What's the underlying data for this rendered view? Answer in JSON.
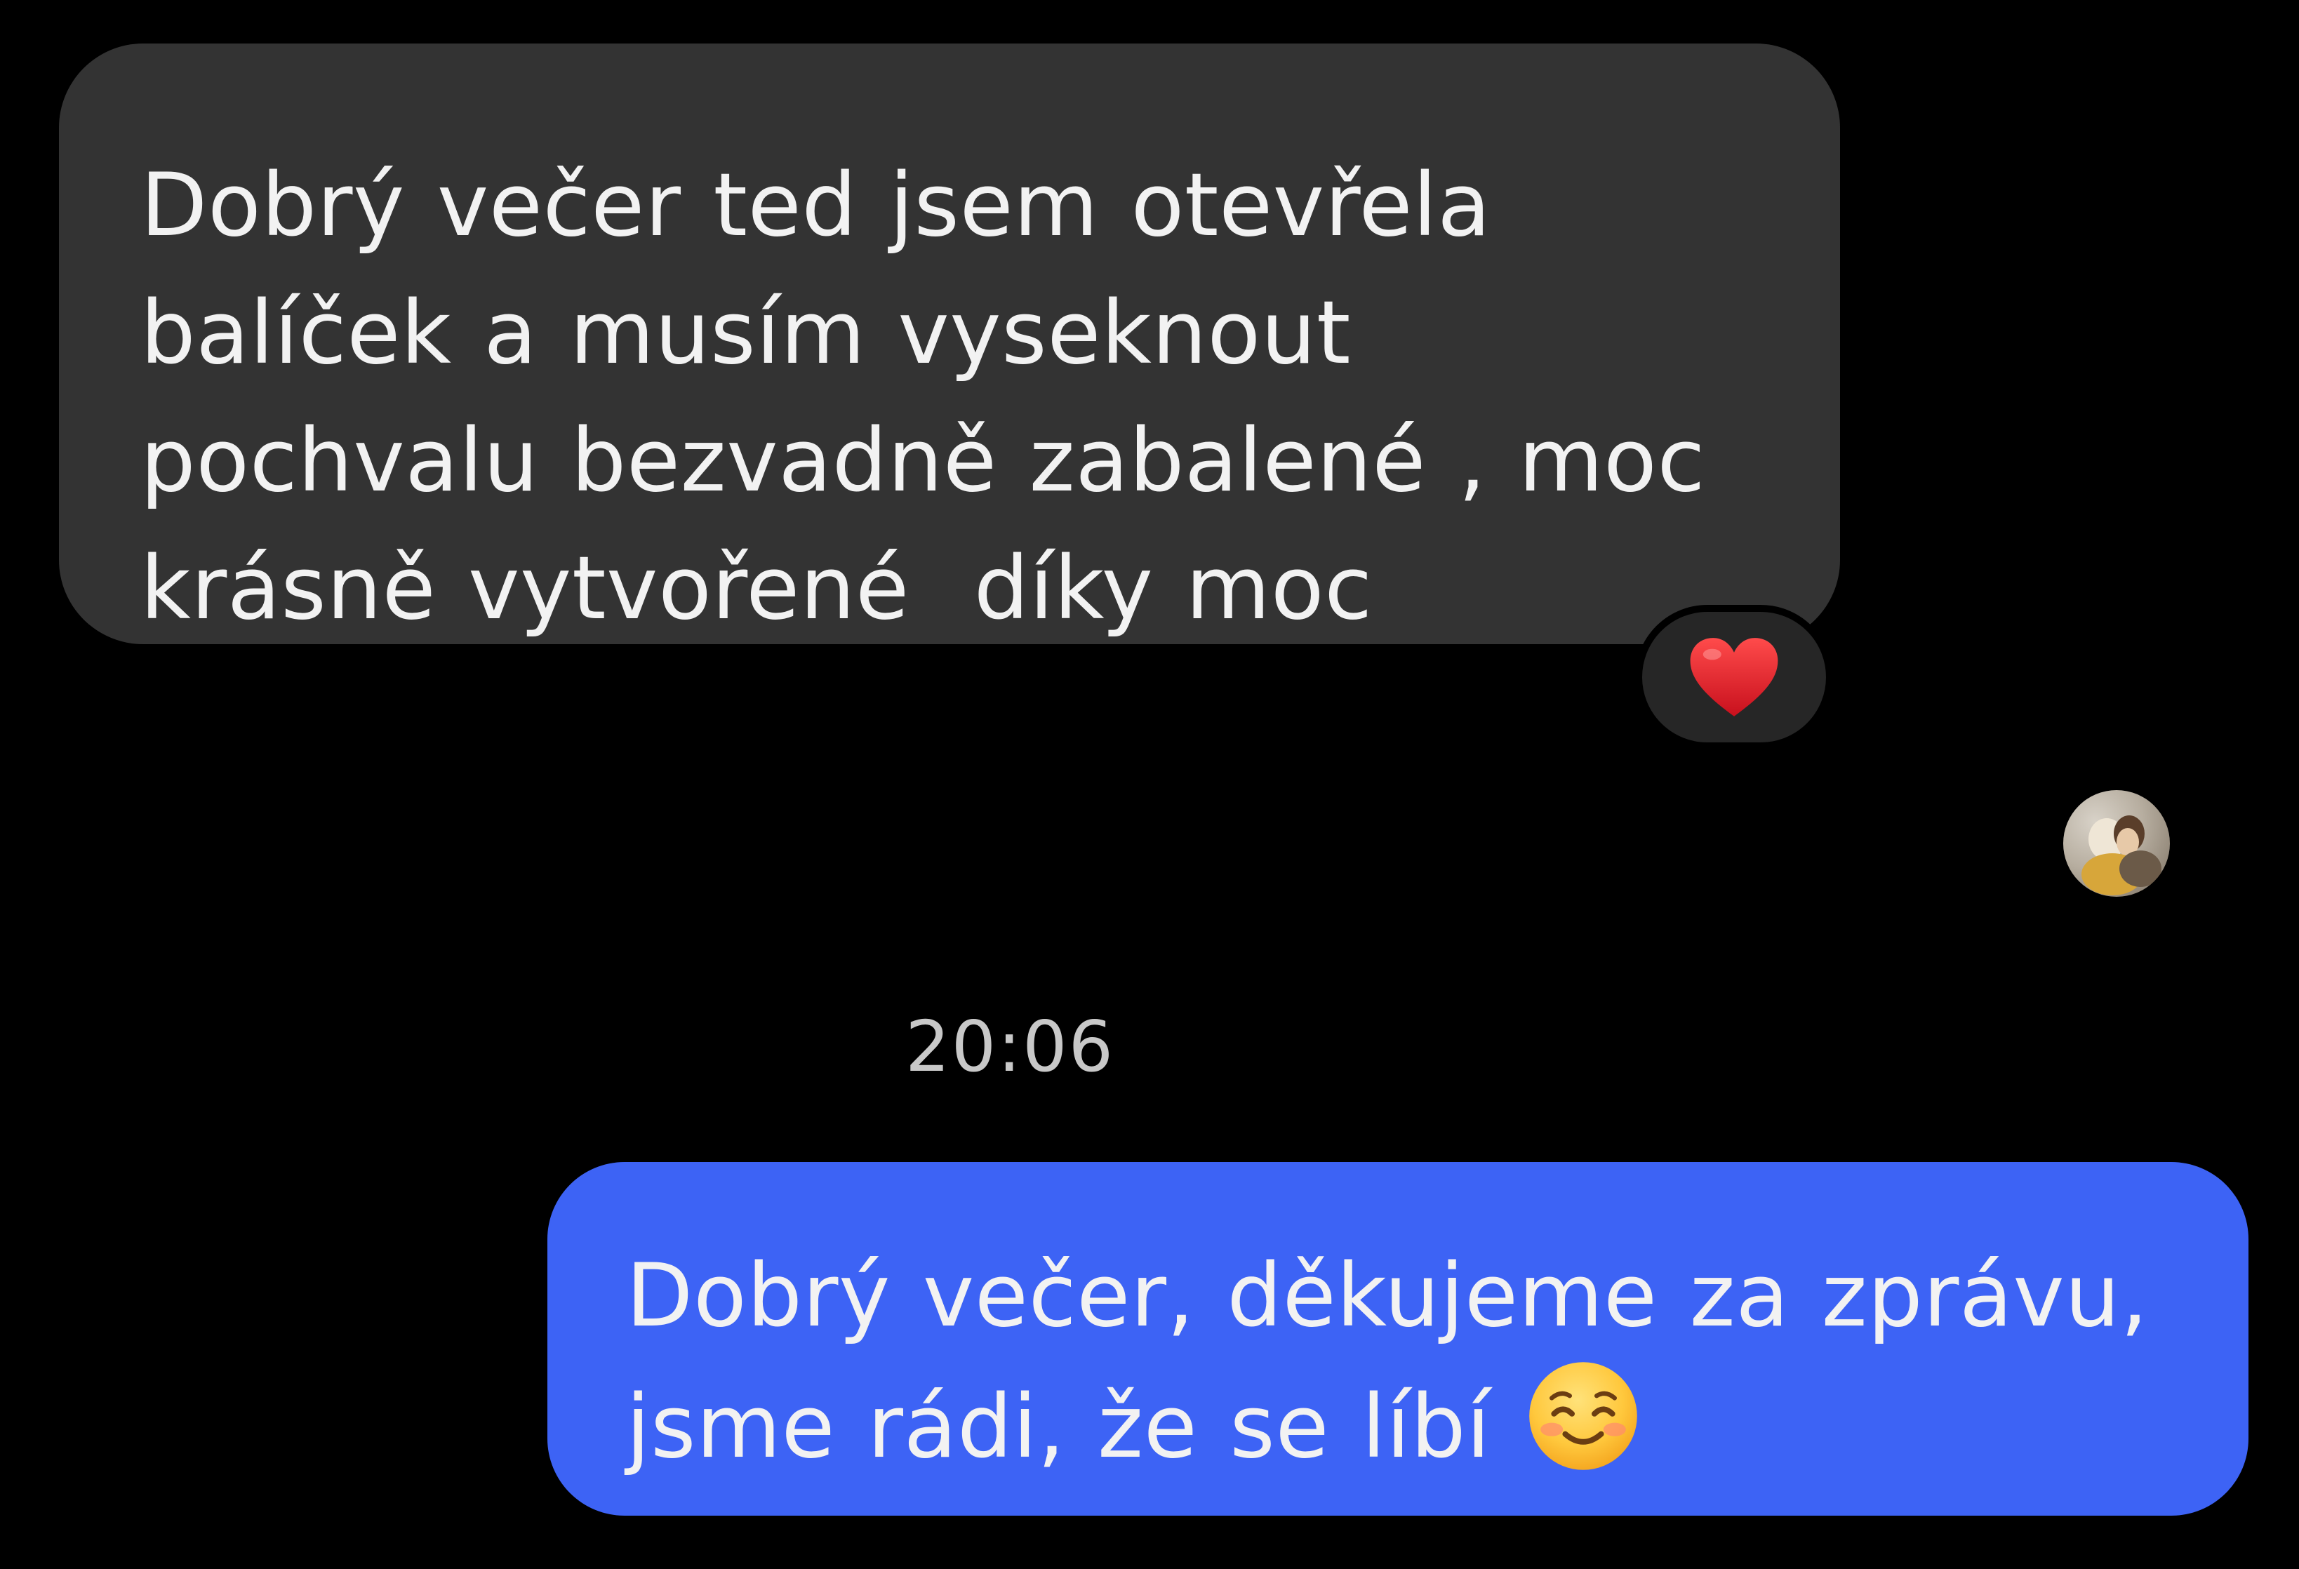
{
  "conversation": {
    "incoming": {
      "lines": [
        "Dobrý večer ted jsem otevřela",
        "balíček a musím vyseknout",
        "pochvalu bezvadně zabalené , moc",
        "krásně vytvořené  díky moc"
      ],
      "bubble_color": "#333333",
      "reaction": "heart-emoji"
    },
    "avatar": "user-avatar",
    "timestamp": "20:06",
    "outgoing": {
      "lines": [
        "Dobrý večer, děkujeme za zprávu,",
        "jsme rádi, že se líbí"
      ],
      "emoji": "smiling-face-emoji",
      "bubble_color": "#3d63f5"
    }
  },
  "colors": {
    "background": "#000000",
    "text": "#f2f2f2",
    "timestamp": "#c8c8c8",
    "reaction_bg": "#262626",
    "heart": "#e8262f"
  }
}
